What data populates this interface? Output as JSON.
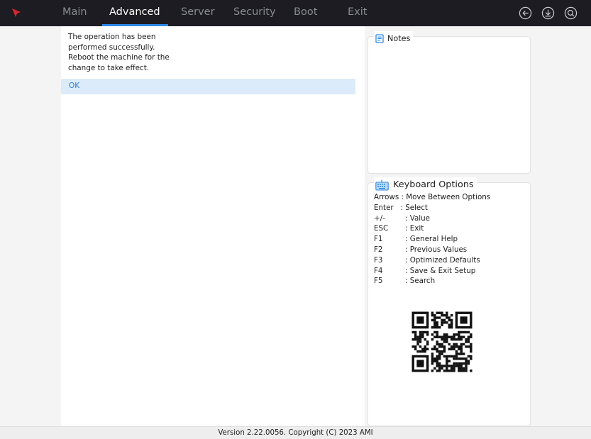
{
  "tabs": [
    {
      "label": "Main",
      "active": false
    },
    {
      "label": "Advanced",
      "active": true
    },
    {
      "label": "Server",
      "active": false
    },
    {
      "label": "Security",
      "active": false
    },
    {
      "label": "Boot",
      "active": false
    },
    {
      "label": "Exit",
      "active": false
    }
  ],
  "top_icons": [
    "back-circle-icon",
    "download-circle-icon",
    "search-circle-icon"
  ],
  "message": {
    "lines": [
      "The operation has been",
      "performed successfully.",
      "Reboot the machine for the",
      "change to take effect."
    ],
    "ok_label": "OK"
  },
  "notes": {
    "title": "Notes",
    "icon": "notes-icon"
  },
  "keyboard": {
    "title": "Keyboard Options",
    "icon": "keyboard-icon",
    "arrows": "Arrows : Move Between Options",
    "enter": "Enter   : Select",
    "keys": [
      {
        "key": "+/-",
        "desc": ": Value"
      },
      {
        "key": "ESC",
        "desc": ": Exit"
      },
      {
        "key": "F1",
        "desc": ": General Help"
      },
      {
        "key": "F2",
        "desc": ": Previous Values"
      },
      {
        "key": "F3",
        "desc": ": Optimized Defaults"
      },
      {
        "key": "F4",
        "desc": ": Save & Exit Setup"
      },
      {
        "key": "F5",
        "desc": ": Search"
      }
    ]
  },
  "footer": "Version 2.22.0056. Copyright (C) 2023 AMI",
  "colors": {
    "topbar": "#1c1c22",
    "accent": "#2f89e8",
    "selected_row": "#dcebfa",
    "ok_text": "#2d7fd6",
    "logo": "#d7272e"
  }
}
